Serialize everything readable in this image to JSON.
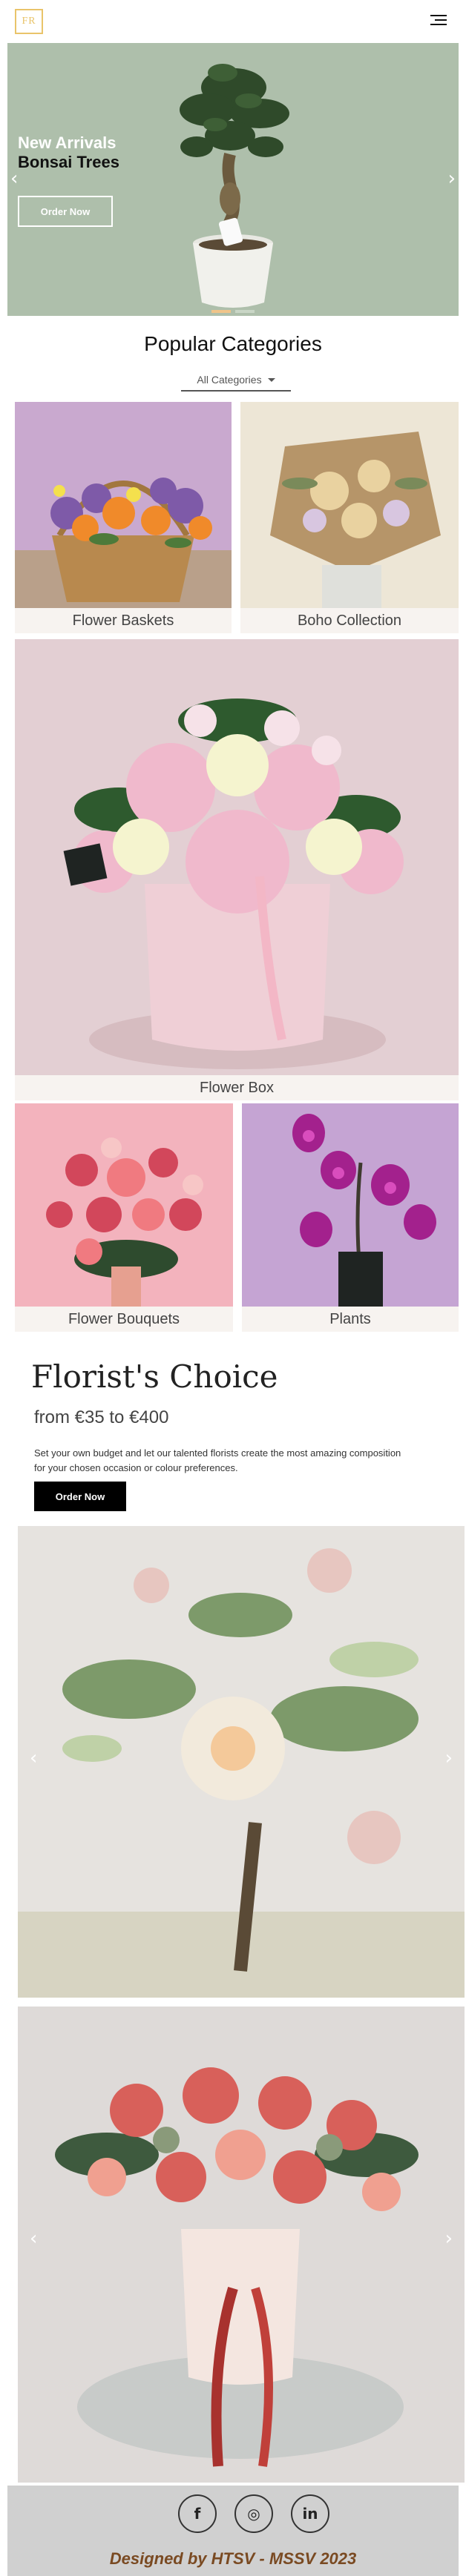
{
  "header": {
    "logo_text": "FR",
    "menu_icon": "hamburger-menu-icon"
  },
  "hero": {
    "title_line1": "New Arrivals",
    "title_line2": "Bonsai Trees",
    "button_label": "Order Now",
    "prev_icon": "chevron-left-icon",
    "next_icon": "chevron-right-icon",
    "slide_count": 2,
    "active_slide": 1,
    "colors": {
      "background": "#aebfab",
      "accent": "#f0c48a"
    }
  },
  "categories": {
    "heading": "Popular Categories",
    "select_value": "All Categories",
    "tiles": [
      {
        "label": "Flower Baskets"
      },
      {
        "label": "Boho Collection"
      },
      {
        "label": "Flower Box"
      },
      {
        "label": "Flower Bouquets"
      },
      {
        "label": "Plants"
      }
    ]
  },
  "florist_choice": {
    "title": "Florist's Choice",
    "price_range": "from €35 to €400",
    "description": "Set your own budget and let our talented florists create the most amazing composition for your chosen occasion or colour preferences.",
    "button_label": "Order Now"
  },
  "gallery": {
    "prev_icon": "chevron-left-icon",
    "next_icon": "chevron-right-icon"
  },
  "footer": {
    "social": [
      {
        "icon": "facebook-icon",
        "glyph": "f"
      },
      {
        "icon": "instagram-icon",
        "glyph": "◎"
      },
      {
        "icon": "linkedin-icon",
        "glyph": "in"
      }
    ],
    "credit": "Designed by HTSV - MSSV 2023"
  }
}
